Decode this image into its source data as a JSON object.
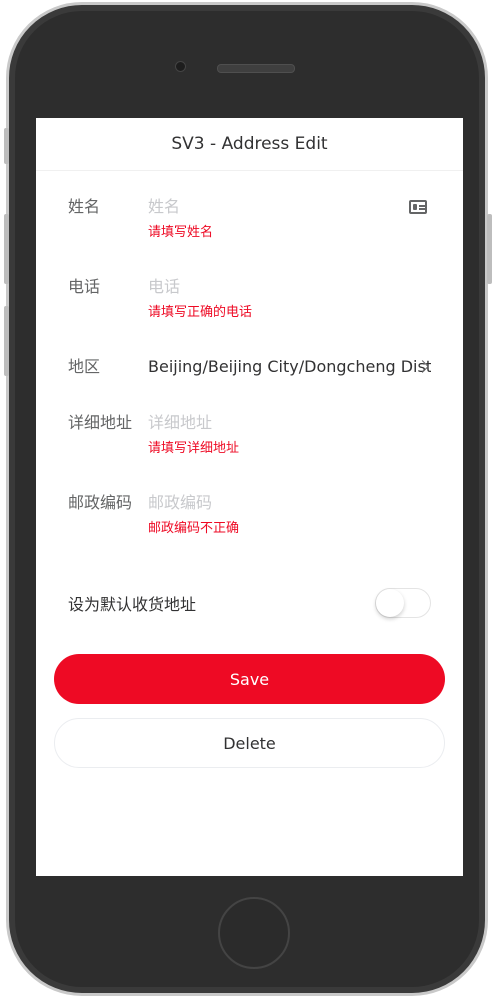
{
  "nav": {
    "title": "SV3 - Address Edit"
  },
  "form": {
    "name": {
      "label": "姓名",
      "placeholder": "姓名",
      "error": "请填写姓名",
      "icon": "contact-card-icon"
    },
    "phone": {
      "label": "电话",
      "placeholder": "电话",
      "error": "请填写正确的电话"
    },
    "region": {
      "label": "地区",
      "value": "Beijing/Beijing City/Dongcheng District",
      "icon": "chevron-right-icon"
    },
    "address": {
      "label": "详细地址",
      "placeholder": "详细地址",
      "error": "请填写详细地址"
    },
    "postal": {
      "label": "邮政编码",
      "placeholder": "邮政编码",
      "error": "邮政编码不正确"
    },
    "default": {
      "label": "设为默认收货地址",
      "enabled": false
    }
  },
  "buttons": {
    "save": "Save",
    "delete": "Delete"
  },
  "colors": {
    "accent": "#ee0a24",
    "text": "#323233",
    "label": "#646566",
    "placeholder": "#c8c9cc"
  }
}
